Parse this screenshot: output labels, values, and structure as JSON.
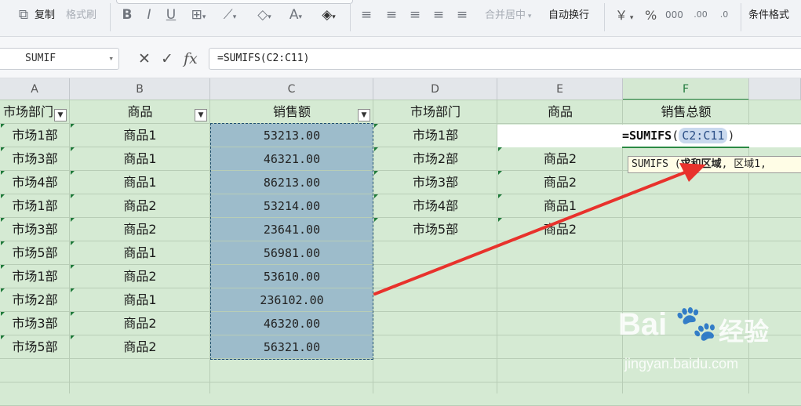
{
  "ribbon": {
    "copy_label": "复制",
    "format_painter_label": "格式刷",
    "merge_center_label": "合并居中",
    "wrap_text_label": "自动换行",
    "conditional_format_label": "条件格式",
    "currency_symbol": "￥",
    "percent_symbol": "%"
  },
  "formula_bar": {
    "name_box": "SUMIF",
    "formula": "=SUMIFS(C2:C11)"
  },
  "columns": [
    "A",
    "B",
    "C",
    "D",
    "E",
    "F"
  ],
  "table1": {
    "headers": [
      "市场部门",
      "商品",
      "销售额"
    ],
    "rows": [
      [
        "市场1部",
        "商品1",
        "53213.00"
      ],
      [
        "市场3部",
        "商品1",
        "46321.00"
      ],
      [
        "市场4部",
        "商品1",
        "86213.00"
      ],
      [
        "市场1部",
        "商品2",
        "53214.00"
      ],
      [
        "市场3部",
        "商品2",
        "23641.00"
      ],
      [
        "市场5部",
        "商品1",
        "56981.00"
      ],
      [
        "市场1部",
        "商品2",
        "53610.00"
      ],
      [
        "市场2部",
        "商品1",
        "236102.00"
      ],
      [
        "市场3部",
        "商品2",
        "46320.00"
      ],
      [
        "市场5部",
        "商品2",
        "56321.00"
      ]
    ]
  },
  "table2": {
    "headers": [
      "市场部门",
      "商品",
      "销售总额"
    ],
    "rows": [
      [
        "市场1部",
        ""
      ],
      [
        "市场2部",
        "商品2"
      ],
      [
        "市场3部",
        "商品2"
      ],
      [
        "市场4部",
        "商品1"
      ],
      [
        "市场5部",
        "商品2"
      ]
    ]
  },
  "editing_cell": {
    "prefix": "=SUMIFS",
    "open_paren": "(",
    "range_ref": "C2:C11",
    "close_paren": ")"
  },
  "tooltip": {
    "fn": "SUMIFS",
    "paren": " (",
    "bold_arg": "求和区域",
    "rest": ", 区域1,"
  },
  "watermark": {
    "brand": "Bai",
    "brand_cn": "经验",
    "url": "jingyan.baidu.com"
  },
  "colors": {
    "sheet_bg": "#d5ead3",
    "selection_fill": "#9dbccb",
    "arrow": "#e8322c",
    "accent_green": "#2b8a44"
  }
}
